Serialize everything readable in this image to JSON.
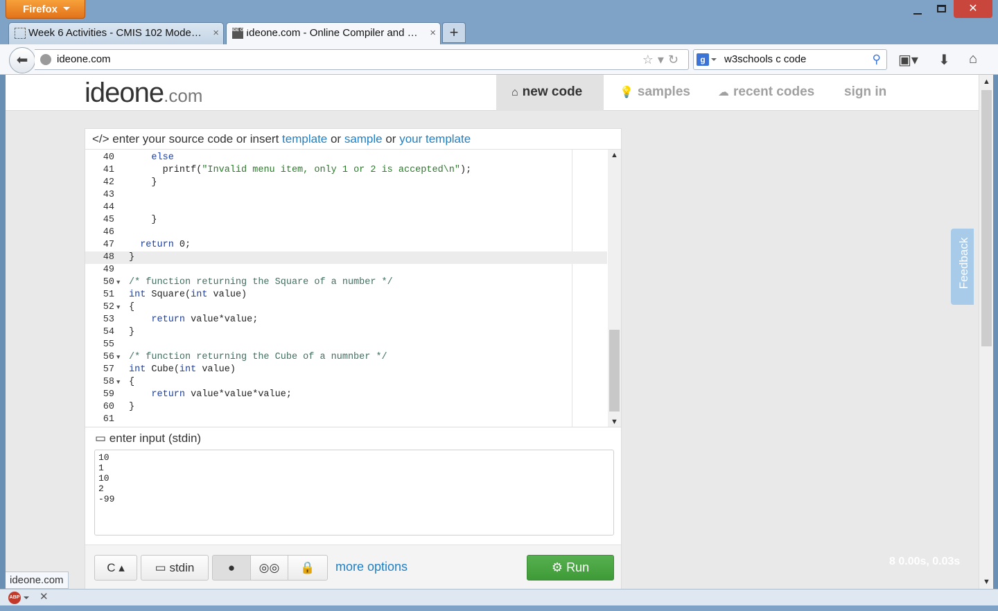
{
  "browser": {
    "menu_label": "Firefox",
    "tabs": [
      {
        "title": "Week 6 Activities - CMIS 102 Model I...",
        "close": "×"
      },
      {
        "title": "Ideone.com - Online Compiler and ID...",
        "close": "×",
        "favicon_text": "IDE ONE"
      }
    ],
    "new_tab": "+",
    "url": "ideone.com",
    "search_engine": "g",
    "search_query": "w3schools c code",
    "status_url": "ideone.com",
    "icons": [
      "back-arrow-icon",
      "globe-icon",
      "star-icon",
      "reload-icon",
      "search-icon",
      "bookmarks-icon",
      "download-icon",
      "home-icon",
      "adblock-icon"
    ]
  },
  "site": {
    "logo_main": "ideone",
    "logo_suffix": ".com",
    "nav": {
      "new_code": "new code",
      "samples": "samples",
      "recent_codes": "recent codes",
      "sign_in": "sign in"
    },
    "editor_header": {
      "prefix": "</> enter your source code or insert ",
      "template": "template",
      "or1": " or ",
      "sample": "sample",
      "or2": " or ",
      "your_template": "your template"
    },
    "code_lines": [
      {
        "n": "40",
        "fold": "",
        "text": "    else"
      },
      {
        "n": "41",
        "fold": "",
        "text": "      printf(\"Invalid menu item, only 1 or 2 is accepted\\n\");"
      },
      {
        "n": "42",
        "fold": "",
        "text": "    }"
      },
      {
        "n": "43",
        "fold": "",
        "text": ""
      },
      {
        "n": "44",
        "fold": "",
        "text": ""
      },
      {
        "n": "45",
        "fold": "",
        "text": "    }"
      },
      {
        "n": "46",
        "fold": "",
        "text": ""
      },
      {
        "n": "47",
        "fold": "",
        "text": "  return 0;"
      },
      {
        "n": "48",
        "fold": "",
        "text": "}",
        "active": true
      },
      {
        "n": "49",
        "fold": "",
        "text": ""
      },
      {
        "n": "50",
        "fold": "▼",
        "text": "/* function returning the Square of a number */"
      },
      {
        "n": "51",
        "fold": "",
        "text": "int Square(int value)"
      },
      {
        "n": "52",
        "fold": "▼",
        "text": "{"
      },
      {
        "n": "53",
        "fold": "",
        "text": "    return value*value;"
      },
      {
        "n": "54",
        "fold": "",
        "text": "}"
      },
      {
        "n": "55",
        "fold": "",
        "text": ""
      },
      {
        "n": "56",
        "fold": "▼",
        "text": "/* function returning the Cube of a numnber */"
      },
      {
        "n": "57",
        "fold": "",
        "text": "int Cube(int value)"
      },
      {
        "n": "58",
        "fold": "▼",
        "text": "{"
      },
      {
        "n": "59",
        "fold": "",
        "text": "    return value*value*value;"
      },
      {
        "n": "60",
        "fold": "",
        "text": "}"
      },
      {
        "n": "61",
        "fold": "",
        "text": ""
      }
    ],
    "stdin_label": "enter input (stdin)",
    "stdin_value": "10\n1\n10\n2\n-99",
    "toolbar": {
      "language": "C",
      "stdin_button": "stdin",
      "more_options": "more options",
      "run": "Run"
    },
    "feedback": "Feedback",
    "stats": "8  0.00s, 0.03s"
  },
  "colors": {
    "link": "#1f7fc2",
    "run_button": "#4aa642",
    "firefox_button": "#e8821f",
    "window_frame": "#7ea3c6"
  }
}
